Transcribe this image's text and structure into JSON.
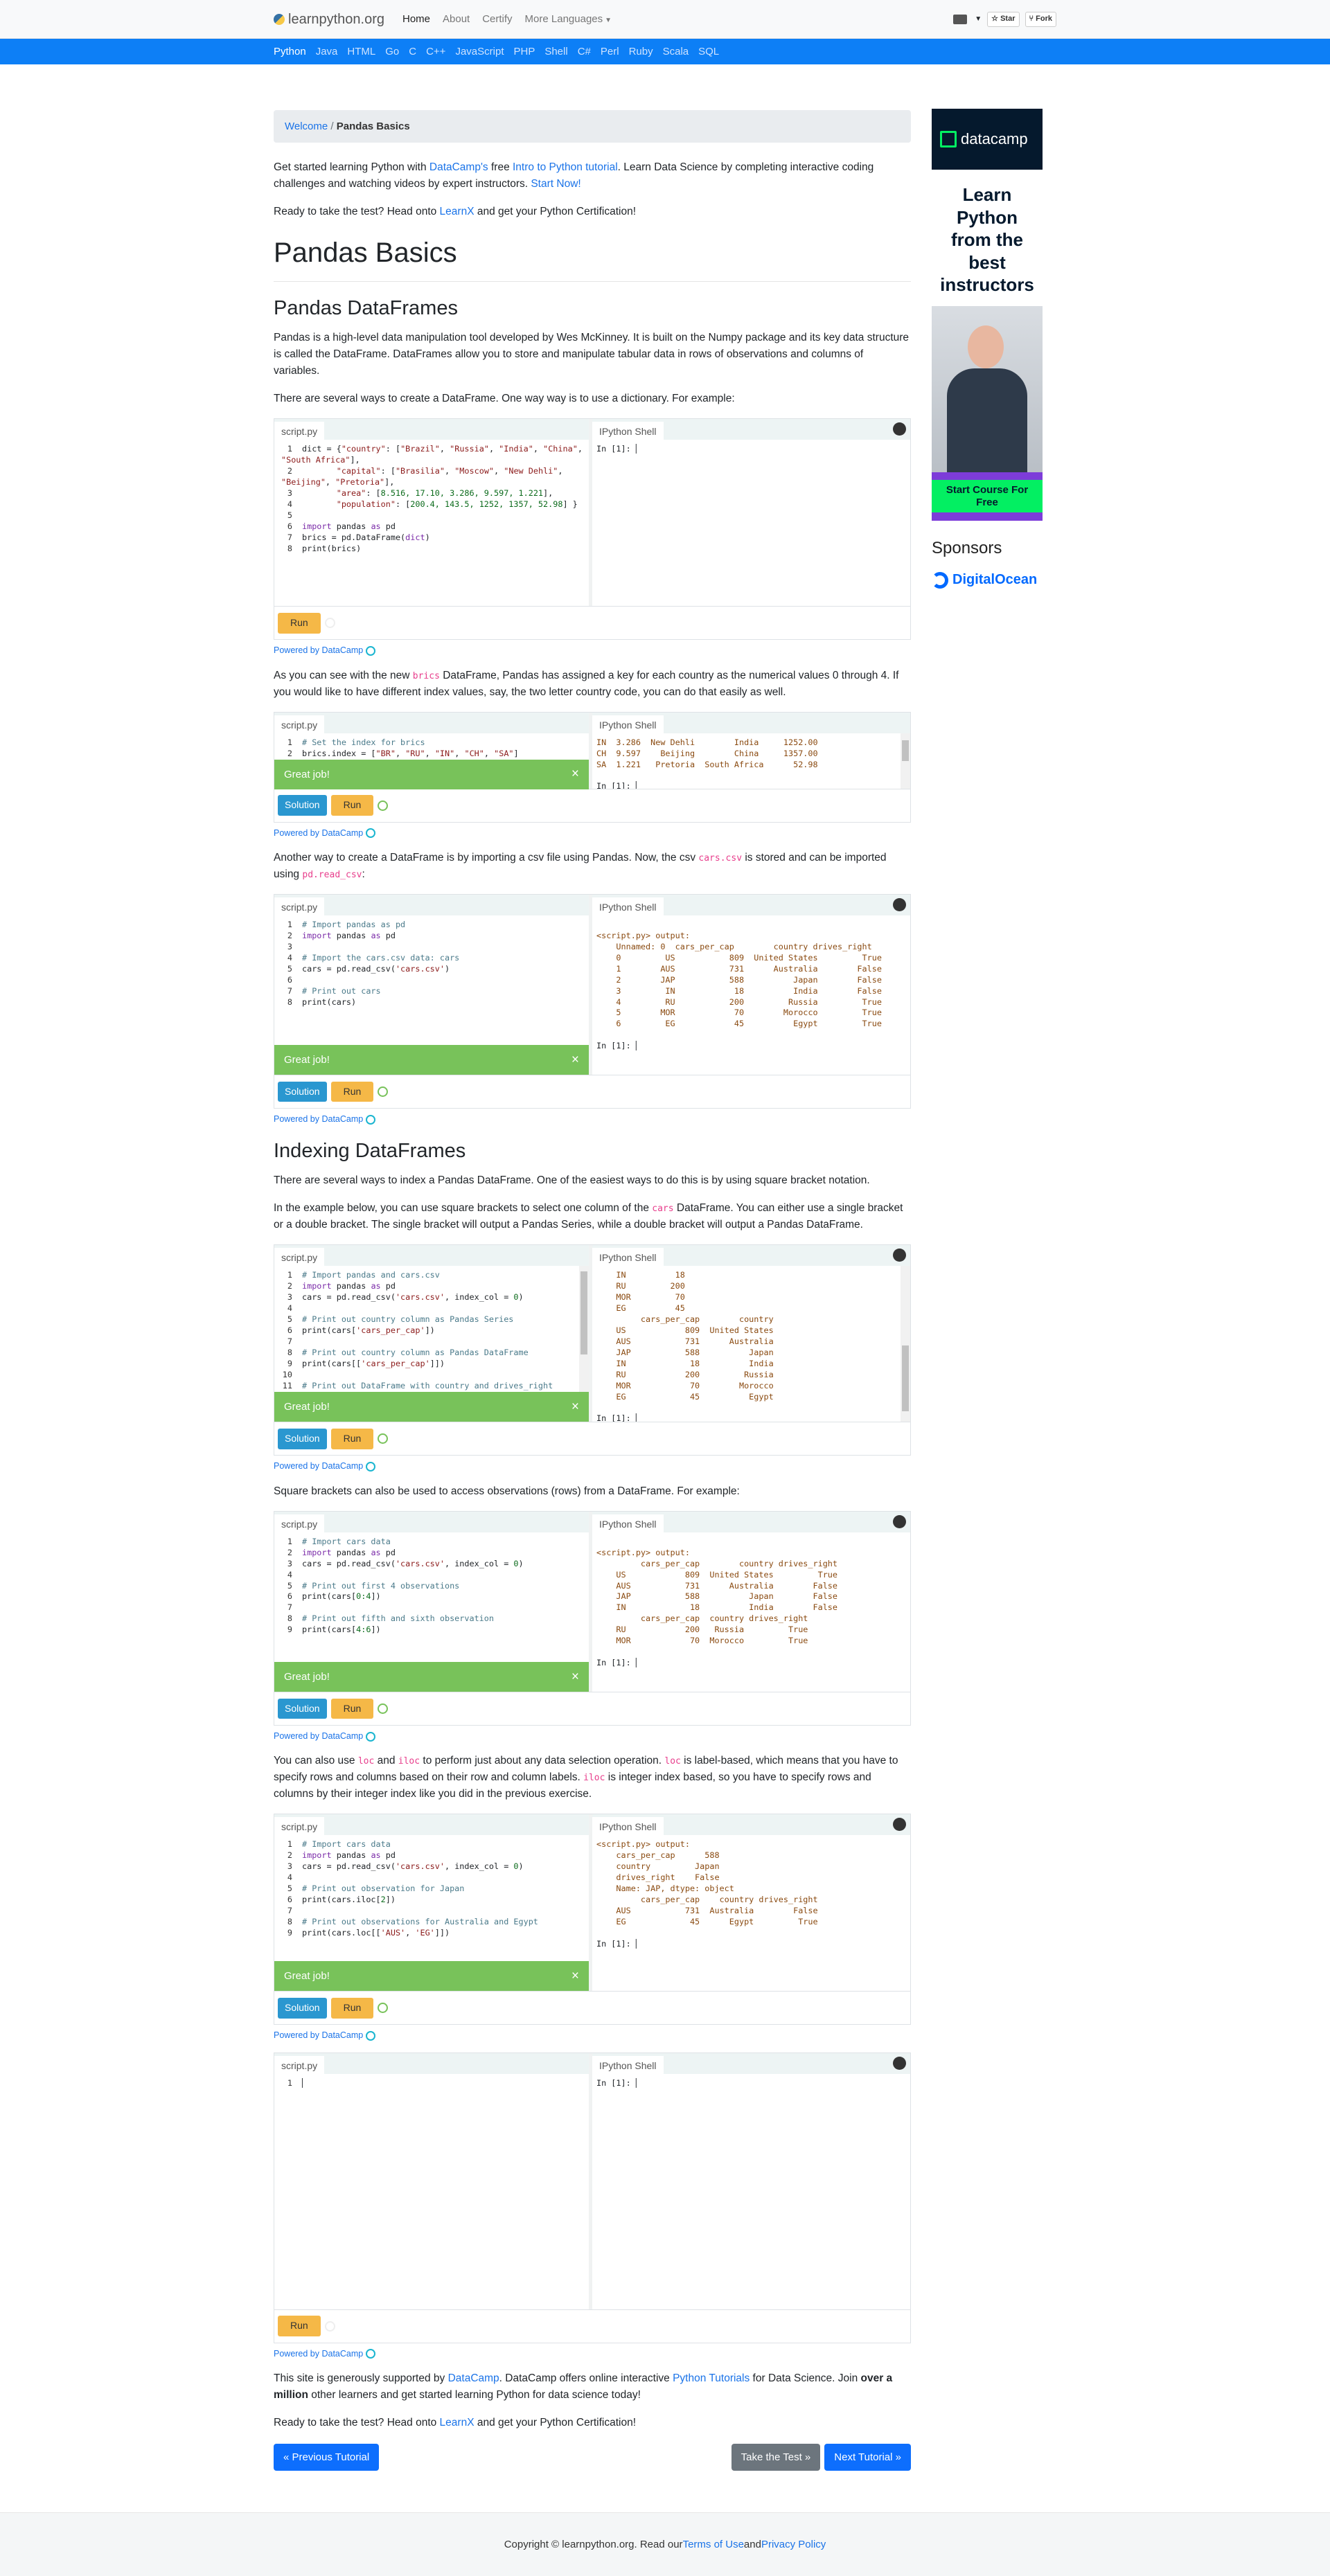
{
  "nav": {
    "brand": "learnpython.org",
    "links": [
      "Home",
      "About",
      "Certify",
      "More Languages"
    ],
    "star": "Star",
    "fork": "Fork"
  },
  "languages": [
    "Python",
    "Java",
    "HTML",
    "Go",
    "C",
    "C++",
    "JavaScript",
    "PHP",
    "Shell",
    "C#",
    "Perl",
    "Ruby",
    "Scala",
    "SQL"
  ],
  "breadcrumb": {
    "home": "Welcome",
    "separator": "/",
    "current": "Pandas Basics"
  },
  "intro": {
    "p1_a": "Get started learning Python with ",
    "p1_link1": "DataCamp's",
    "p1_b": " free ",
    "p1_link2": "Intro to Python tutorial",
    "p1_c": ". Learn Data Science by completing interactive coding challenges and watching videos by expert instructors. ",
    "p1_link3": "Start Now!",
    "p2_a": "Ready to take the test? Head onto ",
    "p2_link": "LearnX",
    "p2_b": " and get your Python Certification!"
  },
  "title": "Pandas Basics",
  "section1": {
    "heading": "Pandas DataFrames",
    "p1": "Pandas is a high-level data manipulation tool developed by Wes McKinney. It is built on the Numpy package and its key data structure is called the DataFrame. DataFrames allow you to store and manipulate tabular data in rows of observations and columns of variables.",
    "p2": "There are several ways to create a DataFrame. One way way is to use a dictionary. For example:",
    "p3_a": "As you can see with the new ",
    "p3_code": "brics",
    "p3_b": " DataFrame, Pandas has assigned a key for each country as the numerical values 0 through 4. If you would like to have different index values, say, the two letter country code, you can do that easily as well.",
    "p4_a": "Another way to create a DataFrame is by importing a csv file using Pandas. Now, the csv ",
    "p4_code1": "cars.csv",
    "p4_b": " is stored and can be imported using ",
    "p4_code2": "pd.read_csv",
    "p4_c": ":"
  },
  "section2": {
    "heading": "Indexing DataFrames",
    "p1": "There are several ways to index a Pandas DataFrame. One of the easiest ways to do this is by using square bracket notation.",
    "p2_a": "In the example below, you can use square brackets to select one column of the ",
    "p2_code": "cars",
    "p2_b": " DataFrame. You can either use a single bracket or a double bracket. The single bracket will output a Pandas Series, while a double bracket will output a Pandas DataFrame.",
    "p3": "Square brackets can also be used to access observations (rows) from a DataFrame. For example:",
    "p4_a": "You can also use ",
    "p4_code1": "loc",
    "p4_b": " and ",
    "p4_code2": "iloc",
    "p4_c": " to perform just about any data selection operation. ",
    "p4_code3": "loc",
    "p4_d": " is label-based, which means that you have to specify rows and columns based on their row and column labels. ",
    "p4_code4": "iloc",
    "p4_e": " is integer index based, so you have to specify rows and columns by their integer index like you did in the previous exercise."
  },
  "widget": {
    "script_tab": "script.py",
    "shell_tab": "IPython Shell",
    "great_job": "Great job!",
    "close": "×",
    "solution": "Solution",
    "run": "Run",
    "powered": "Powered by DataCamp",
    "prompt": "In [1]:"
  },
  "outro": {
    "p1_a": "This site is generously supported by ",
    "p1_link1": "DataCamp",
    "p1_b": ". DataCamp offers online interactive ",
    "p1_link2": "Python Tutorials",
    "p1_c": " for Data Science. Join ",
    "p1_bold": "over a million",
    "p1_d": " other learners and get started learning Python for data science today!",
    "p2_a": "Ready to take the test? Head onto ",
    "p2_link": "LearnX",
    "p2_b": " and get your Python Certification!"
  },
  "buttons": {
    "prev": "« Previous Tutorial",
    "test": "Take the Test »",
    "next": "Next Tutorial »"
  },
  "ad": {
    "brand": "datacamp",
    "headline": "Learn Python from the best instructors",
    "cta": "Start Course For Free"
  },
  "sponsors": {
    "heading": "Sponsors",
    "name": "DigitalOcean"
  },
  "footer": {
    "a": "Copyright © learnpython.org. Read our ",
    "link1": "Terms of Use",
    "b": " and ",
    "link2": "Privacy Policy"
  },
  "colors": {
    "accent": "#0d7ff6",
    "great": "#78c25a",
    "run": "#f5b847",
    "solution": "#2a97d0"
  }
}
